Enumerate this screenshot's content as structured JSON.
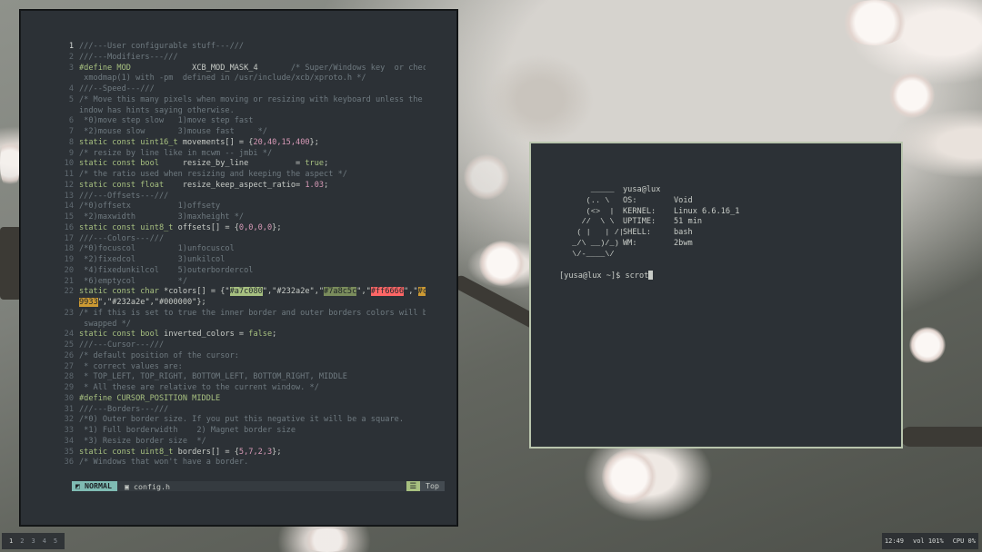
{
  "editor": {
    "lines": [
      {
        "n": "1",
        "current": true,
        "parts": [
          [
            "cm",
            "///---User configurable stuff---///"
          ]
        ]
      },
      {
        "n": "2",
        "parts": [
          [
            "cm",
            "///---Modifiers---///"
          ]
        ]
      },
      {
        "n": "3",
        "parts": [
          [
            "kw",
            "#define MOD"
          ],
          [
            "str",
            "             XCB_MOD_MASK_4       "
          ],
          [
            "cm",
            "/* Super/Windows key  or check"
          ]
        ]
      },
      {
        "n": "",
        "parts": [
          [
            "cm",
            " xmodmap(1) with -pm  defined in /usr/include/xcb/xproto.h */"
          ]
        ]
      },
      {
        "n": "4",
        "parts": [
          [
            "cm",
            "///--Speed---///"
          ]
        ]
      },
      {
        "n": "5",
        "parts": [
          [
            "cm",
            "/* Move this many pixels when moving or resizing with keyboard unless the w"
          ]
        ]
      },
      {
        "n": "",
        "parts": [
          [
            "cm",
            "indow has hints saying otherwise."
          ]
        ]
      },
      {
        "n": "6",
        "parts": [
          [
            "cm",
            " *0)move step slow   1)move step fast"
          ]
        ]
      },
      {
        "n": "7",
        "parts": [
          [
            "cm",
            " *2)mouse slow       3)mouse fast     */"
          ]
        ]
      },
      {
        "n": "8",
        "parts": [
          [
            "kw",
            "static const uint16_t"
          ],
          [
            "str",
            " movements[] = {"
          ],
          [
            "num",
            "20,40,15,400"
          ],
          [
            "str",
            "};"
          ]
        ]
      },
      {
        "n": "9",
        "parts": [
          [
            "cm",
            "/* resize by line like in mcwm -- jmbi */"
          ]
        ]
      },
      {
        "n": "10",
        "parts": [
          [
            "kw",
            "static const bool"
          ],
          [
            "str",
            "     resize_by_line          = "
          ],
          [
            "kw",
            "true"
          ],
          [
            "str",
            ";"
          ]
        ]
      },
      {
        "n": "11",
        "parts": [
          [
            "cm",
            "/* the ratio used when resizing and keeping the aspect */"
          ]
        ]
      },
      {
        "n": "12",
        "parts": [
          [
            "kw",
            "static const float"
          ],
          [
            "str",
            "    resize_keep_aspect_ratio= "
          ],
          [
            "num",
            "1.03"
          ],
          [
            "str",
            ";"
          ]
        ]
      },
      {
        "n": "13",
        "parts": [
          [
            "cm",
            "///---Offsets---///"
          ]
        ]
      },
      {
        "n": "14",
        "parts": [
          [
            "cm",
            "/*0)offsetx          1)offsety"
          ]
        ]
      },
      {
        "n": "15",
        "parts": [
          [
            "cm",
            " *2)maxwidth         3)maxheight */"
          ]
        ]
      },
      {
        "n": "16",
        "parts": [
          [
            "kw",
            "static const uint8_t"
          ],
          [
            "str",
            " offsets[] = {"
          ],
          [
            "num",
            "0,0,0,0"
          ],
          [
            "str",
            "};"
          ]
        ]
      },
      {
        "n": "17",
        "parts": [
          [
            "cm",
            "///---Colors---///"
          ]
        ]
      },
      {
        "n": "18",
        "parts": [
          [
            "cm",
            "/*0)focuscol         1)unfocuscol"
          ]
        ]
      },
      {
        "n": "19",
        "parts": [
          [
            "cm",
            " *2)fixedcol         3)unkilcol"
          ]
        ]
      },
      {
        "n": "20",
        "parts": [
          [
            "cm",
            " *4)fixedunkilcol    5)outerbordercol"
          ]
        ]
      },
      {
        "n": "21",
        "parts": [
          [
            "cm",
            " *6)emptycol         */"
          ]
        ]
      },
      {
        "n": "22",
        "parts": [
          [
            "kw",
            "static const char"
          ],
          [
            "str",
            " *colors[] = {\""
          ],
          [
            "hl-a",
            "#a7c080"
          ],
          [
            "str",
            "\",\"#232a2e\",\""
          ],
          [
            "hl-b",
            "#7a8c5c"
          ],
          [
            "str",
            "\",\""
          ],
          [
            "hl-c",
            "#ff6666"
          ],
          [
            "str",
            "\",\""
          ],
          [
            "hl-d",
            "#cc"
          ]
        ]
      },
      {
        "n": "",
        "parts": [
          [
            "hl-d",
            "9933"
          ],
          [
            "str",
            "\",\"#232a2e\",\"#000000\"};"
          ]
        ]
      },
      {
        "n": "23",
        "parts": [
          [
            "cm",
            "/* if this is set to true the inner border and outer borders colors will be"
          ]
        ]
      },
      {
        "n": "",
        "parts": [
          [
            "cm",
            " swapped */"
          ]
        ]
      },
      {
        "n": "24",
        "parts": [
          [
            "kw",
            "static const bool"
          ],
          [
            "str",
            " inverted_colors = "
          ],
          [
            "kw",
            "false"
          ],
          [
            "str",
            ";"
          ]
        ]
      },
      {
        "n": "25",
        "parts": [
          [
            "cm",
            "///---Cursor---///"
          ]
        ]
      },
      {
        "n": "26",
        "parts": [
          [
            "cm",
            "/* default position of the cursor:"
          ]
        ]
      },
      {
        "n": "27",
        "parts": [
          [
            "cm",
            " * correct values are:"
          ]
        ]
      },
      {
        "n": "28",
        "parts": [
          [
            "cm",
            " * TOP_LEFT, TOP_RIGHT, BOTTOM_LEFT, BOTTOM_RIGHT, MIDDLE"
          ]
        ]
      },
      {
        "n": "29",
        "parts": [
          [
            "cm",
            " * All these are relative to the current window. */"
          ]
        ]
      },
      {
        "n": "30",
        "parts": [
          [
            "kw",
            "#define CURSOR_POSITION MIDDLE"
          ]
        ]
      },
      {
        "n": "31",
        "parts": [
          [
            "cm",
            "///---Borders---///"
          ]
        ]
      },
      {
        "n": "32",
        "parts": [
          [
            "cm",
            "/*0) Outer border size. If you put this negative it will be a square."
          ]
        ]
      },
      {
        "n": "33",
        "parts": [
          [
            "cm",
            " *1) Full borderwidth    2) Magnet border size"
          ]
        ]
      },
      {
        "n": "34",
        "parts": [
          [
            "cm",
            " *3) Resize border size  */"
          ]
        ]
      },
      {
        "n": "35",
        "parts": [
          [
            "kw",
            "static const uint8_t"
          ],
          [
            "str",
            " borders[] = {"
          ],
          [
            "num",
            "5,7,2,3"
          ],
          [
            "str",
            "};"
          ]
        ]
      },
      {
        "n": "36",
        "parts": [
          [
            "cm",
            "/* Windows that won't have a border."
          ]
        ]
      }
    ],
    "status": {
      "mode": "NORMAL",
      "file": "config.h",
      "position": "Top"
    }
  },
  "terminal": {
    "ascii": "     _____\n    (.. \\\n    (<>  |\n   //  \\ \\\n  ( |   | /|\n _/\\ __)/_)\n \\/-____\\/",
    "user_host": "yusa@lux",
    "info": [
      {
        "key": "OS:",
        "value": "Void"
      },
      {
        "key": "KERNEL:",
        "value": "Linux 6.6.16_1"
      },
      {
        "key": "UPTIME:",
        "value": "51 min"
      },
      {
        "key": "SHELL:",
        "value": "bash"
      },
      {
        "key": "WM:",
        "value": "2bwm"
      }
    ],
    "prompt": "[yusa@lux ~]$ ",
    "command": "scrot"
  },
  "bar": {
    "workspaces": [
      "1",
      "2",
      "3",
      "4",
      "5"
    ],
    "active_workspace": "1",
    "clock": "12:49",
    "volume": "vol 101%",
    "cpu": "CPU  0%"
  },
  "colors": {
    "editor_bg": "#2c3136",
    "accent_green": "#a7c080",
    "accent_teal": "#7fbbb3",
    "terminal_border": "#b9c5ad"
  }
}
